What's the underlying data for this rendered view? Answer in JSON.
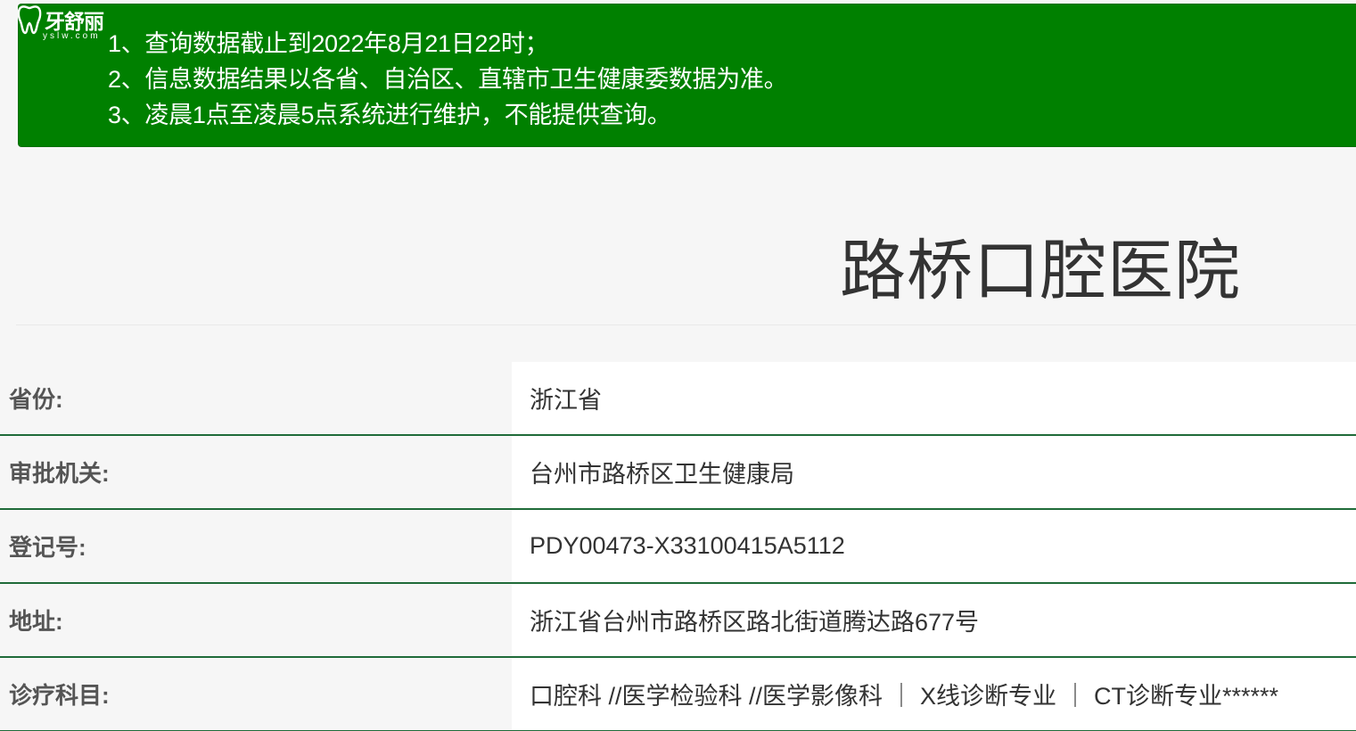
{
  "watermark": {
    "brand": "牙舒丽",
    "domain": "yslw.com"
  },
  "notice": {
    "items": [
      "1、查询数据截止到2022年8月21日22时；",
      "2、信息数据结果以各省、自治区、直辖市卫生健康委数据为准。",
      "3、凌晨1点至凌晨5点系统进行维护，不能提供查询。"
    ]
  },
  "hospital": {
    "name": "路桥口腔医院"
  },
  "details": [
    {
      "label": "省份:",
      "value": "浙江省"
    },
    {
      "label": "审批机关:",
      "value": "台州市路桥区卫生健康局"
    },
    {
      "label": "登记号:",
      "value": "PDY00473-X33100415A5112"
    },
    {
      "label": "地址:",
      "value": "浙江省台州市路桥区路北街道腾达路677号"
    },
    {
      "label": "诊疗科目:",
      "value": "口腔科 //医学检验科 //医学影像科 ｜ X线诊断专业 ｜ CT诊断专业******"
    }
  ],
  "colors": {
    "banner_bg": "#008000",
    "row_border": "#1f6b39",
    "page_bg": "#f6f6f6"
  }
}
